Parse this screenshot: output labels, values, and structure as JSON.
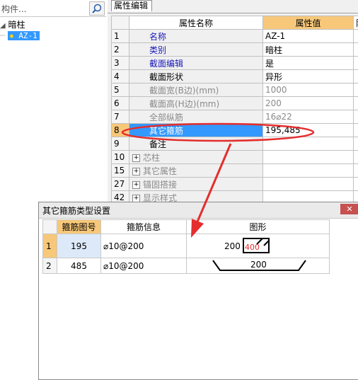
{
  "tree": {
    "search_placeholder": "构件...",
    "root_label": "暗柱",
    "child_label": "AZ-1"
  },
  "tab": {
    "label": "属性编辑"
  },
  "grid": {
    "col_name": "属性名称",
    "col_value": "属性值",
    "col_extra": "附",
    "rows": [
      {
        "num": "1",
        "name": "名称",
        "value": "AZ-1",
        "style": "blue"
      },
      {
        "num": "2",
        "name": "类别",
        "value": "暗柱",
        "style": "blue"
      },
      {
        "num": "3",
        "name": "截面编辑",
        "value": "是",
        "style": "blue"
      },
      {
        "num": "4",
        "name": "截面形状",
        "value": "异形",
        "style": "normal"
      },
      {
        "num": "5",
        "name": "截面宽(B边)(mm)",
        "value": "1000",
        "style": "gray"
      },
      {
        "num": "6",
        "name": "截面高(H边)(mm)",
        "value": "200",
        "style": "gray"
      },
      {
        "num": "7",
        "name": "全部纵筋",
        "value": "16⌀22",
        "style": "gray"
      },
      {
        "num": "8",
        "name": "其它箍筋",
        "value": "195,485",
        "style": "selected"
      },
      {
        "num": "9",
        "name": "备注",
        "value": "",
        "style": "normal"
      },
      {
        "num": "10",
        "name": "芯柱",
        "value": "",
        "style": "group"
      },
      {
        "num": "15",
        "name": "其它属性",
        "value": "",
        "style": "group"
      },
      {
        "num": "27",
        "name": "锚固搭接",
        "value": "",
        "style": "group"
      },
      {
        "num": "42",
        "name": "显示样式",
        "value": "",
        "style": "group"
      }
    ]
  },
  "dialog": {
    "title": "其它箍筋类型设置",
    "close": "✕",
    "col_code": "箍筋图号",
    "col_info": "箍筋信息",
    "col_shape": "图形",
    "rows": [
      {
        "num": "1",
        "code": "195",
        "info": "⌀10@200",
        "dim_a": "200",
        "dim_b": "400"
      },
      {
        "num": "2",
        "code": "485",
        "info": "⌀10@200",
        "dim_a": "200"
      }
    ]
  },
  "colors": {
    "accent_red": "#e52d2d",
    "header_orange": "#f7c87a",
    "selection_blue": "#3399ff"
  }
}
